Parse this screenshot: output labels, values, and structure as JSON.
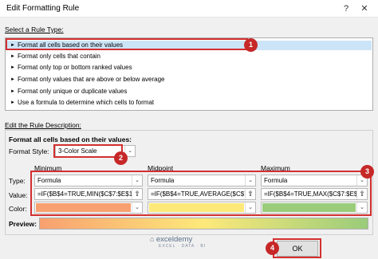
{
  "window": {
    "title": "Edit Formatting Rule",
    "help_glyph": "?",
    "close_glyph": "✕"
  },
  "rule_type": {
    "label": "Select a Rule Type:",
    "items": [
      "Format all cells based on their values",
      "Format only cells that contain",
      "Format only top or bottom ranked values",
      "Format only values that are above or below average",
      "Format only unique or duplicate values",
      "Use a formula to determine which cells to format"
    ],
    "selected_index": 0
  },
  "description": {
    "label": "Edit the Rule Description:",
    "heading": "Format all cells based on their values:",
    "format_style_label": "Format Style:",
    "format_style_value": "3-Color Scale",
    "columns": [
      "Minimum",
      "Midpoint",
      "Maximum"
    ],
    "row_labels": {
      "type": "Type:",
      "value": "Value:",
      "color": "Color:"
    },
    "types": [
      "Formula",
      "Formula",
      "Formula"
    ],
    "values": [
      "=IF($B$4=TRUE,MIN($C$7:$E$1",
      "=IF($B$4=TRUE,AVERAGE($C$7:",
      "=IF($B$4=TRUE,MAX($C$7:$E$"
    ],
    "colors": [
      "#f8a070",
      "#fde97a",
      "#9acc7a"
    ],
    "preview_label": "Preview:"
  },
  "callouts": [
    "1",
    "2",
    "3",
    "4"
  ],
  "buttons": {
    "ok": "OK"
  },
  "watermark": {
    "name": "exceldemy",
    "tagline": "EXCEL · DATA · BI"
  }
}
